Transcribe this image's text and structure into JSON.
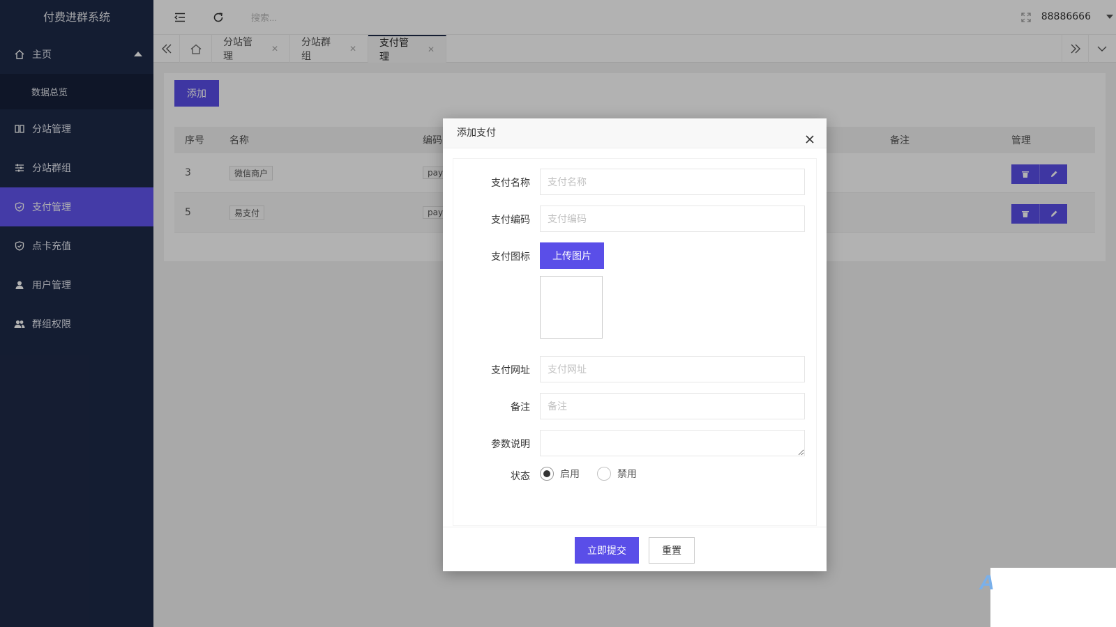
{
  "app": {
    "title": "付费进群系统"
  },
  "sidebar": {
    "home": {
      "label": "主页",
      "icon": "home-icon"
    },
    "sub_items": [
      {
        "label": "数据总览"
      }
    ],
    "items": [
      {
        "label": "分站管理",
        "icon": "columns-icon"
      },
      {
        "label": "分站群组",
        "icon": "sliders-icon"
      },
      {
        "label": "支付管理",
        "icon": "shield-check-icon",
        "active": true
      },
      {
        "label": "点卡充值",
        "icon": "shield-check-icon"
      },
      {
        "label": "用户管理",
        "icon": "user-icon"
      },
      {
        "label": "群组权限",
        "icon": "users-icon"
      }
    ],
    "active_color": "#6255ef",
    "bg_color": "#1e2a48"
  },
  "topbar": {
    "search_placeholder": "搜索...",
    "username": "88886666"
  },
  "tabs": [
    {
      "label": "分站管理"
    },
    {
      "label": "分站群组"
    },
    {
      "label": "支付管理",
      "active": true
    }
  ],
  "main": {
    "add_label": "添加",
    "table": {
      "headers": [
        "序号",
        "名称",
        "编码",
        "备注",
        "管理"
      ],
      "rows": [
        {
          "id": "3",
          "name": "微信商户",
          "code": "payv"
        },
        {
          "id": "5",
          "name": "易支付",
          "code": "pay"
        }
      ]
    }
  },
  "modal": {
    "title": "添加支付",
    "fields": {
      "name": {
        "label": "支付名称",
        "placeholder": "支付名称"
      },
      "code": {
        "label": "支付编码",
        "placeholder": "支付编码"
      },
      "icon": {
        "label": "支付图标",
        "upload_label": "上传图片"
      },
      "url": {
        "label": "支付网址",
        "placeholder": "支付网址"
      },
      "remark": {
        "label": "备注",
        "placeholder": "备注"
      },
      "params": {
        "label": "参数说明",
        "placeholder": ""
      },
      "status": {
        "label": "状态",
        "options": [
          "启用",
          "禁用"
        ],
        "selected": "启用"
      }
    },
    "submit_label": "立即提交",
    "reset_label": "重置"
  },
  "accent_color": "#5a4ee8"
}
